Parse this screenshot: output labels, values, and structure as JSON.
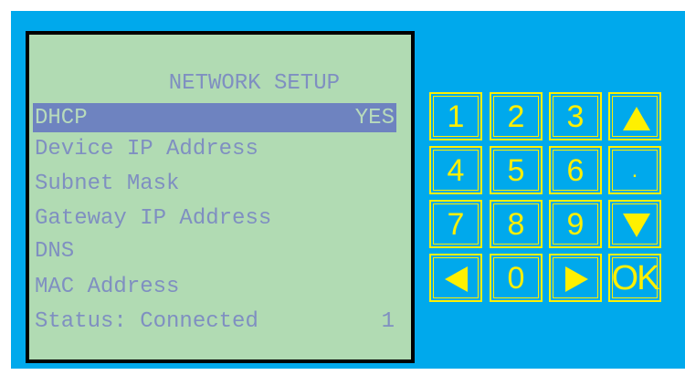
{
  "screen": {
    "title": "NETWORK SETUP",
    "menu": [
      {
        "label": "DHCP",
        "value": "YES",
        "selected": true
      },
      {
        "label": "Device IP Address",
        "value": ""
      },
      {
        "label": "Subnet Mask",
        "value": ""
      },
      {
        "label": "Gateway IP Address",
        "value": ""
      },
      {
        "label": "DNS",
        "value": ""
      },
      {
        "label": "MAC Address",
        "value": ""
      },
      {
        "label": "Status: Connected",
        "value": "1"
      }
    ]
  },
  "keypad": {
    "keys": [
      {
        "label": "1",
        "name": "key-1"
      },
      {
        "label": "2",
        "name": "key-2"
      },
      {
        "label": "3",
        "name": "key-3"
      },
      {
        "label": "",
        "name": "up-arrow-key",
        "icon": "up-arrow-icon"
      },
      {
        "label": "4",
        "name": "key-4"
      },
      {
        "label": "5",
        "name": "key-5"
      },
      {
        "label": "6",
        "name": "key-6"
      },
      {
        "label": ".",
        "name": "key-dot"
      },
      {
        "label": "7",
        "name": "key-7"
      },
      {
        "label": "8",
        "name": "key-8"
      },
      {
        "label": "9",
        "name": "key-9"
      },
      {
        "label": "",
        "name": "down-arrow-key",
        "icon": "down-arrow-icon"
      },
      {
        "label": "",
        "name": "left-arrow-key",
        "icon": "left-arrow-icon"
      },
      {
        "label": "0",
        "name": "key-0"
      },
      {
        "label": "",
        "name": "right-arrow-key",
        "icon": "right-arrow-icon"
      },
      {
        "label": "OK",
        "name": "ok-key"
      }
    ]
  },
  "colors": {
    "panel_background": "#00a9ec",
    "lcd_background": "#b1dbb3",
    "lcd_text": "#7f8fc1",
    "selection_highlight": "#6e83c0",
    "key_color": "#fff000"
  }
}
